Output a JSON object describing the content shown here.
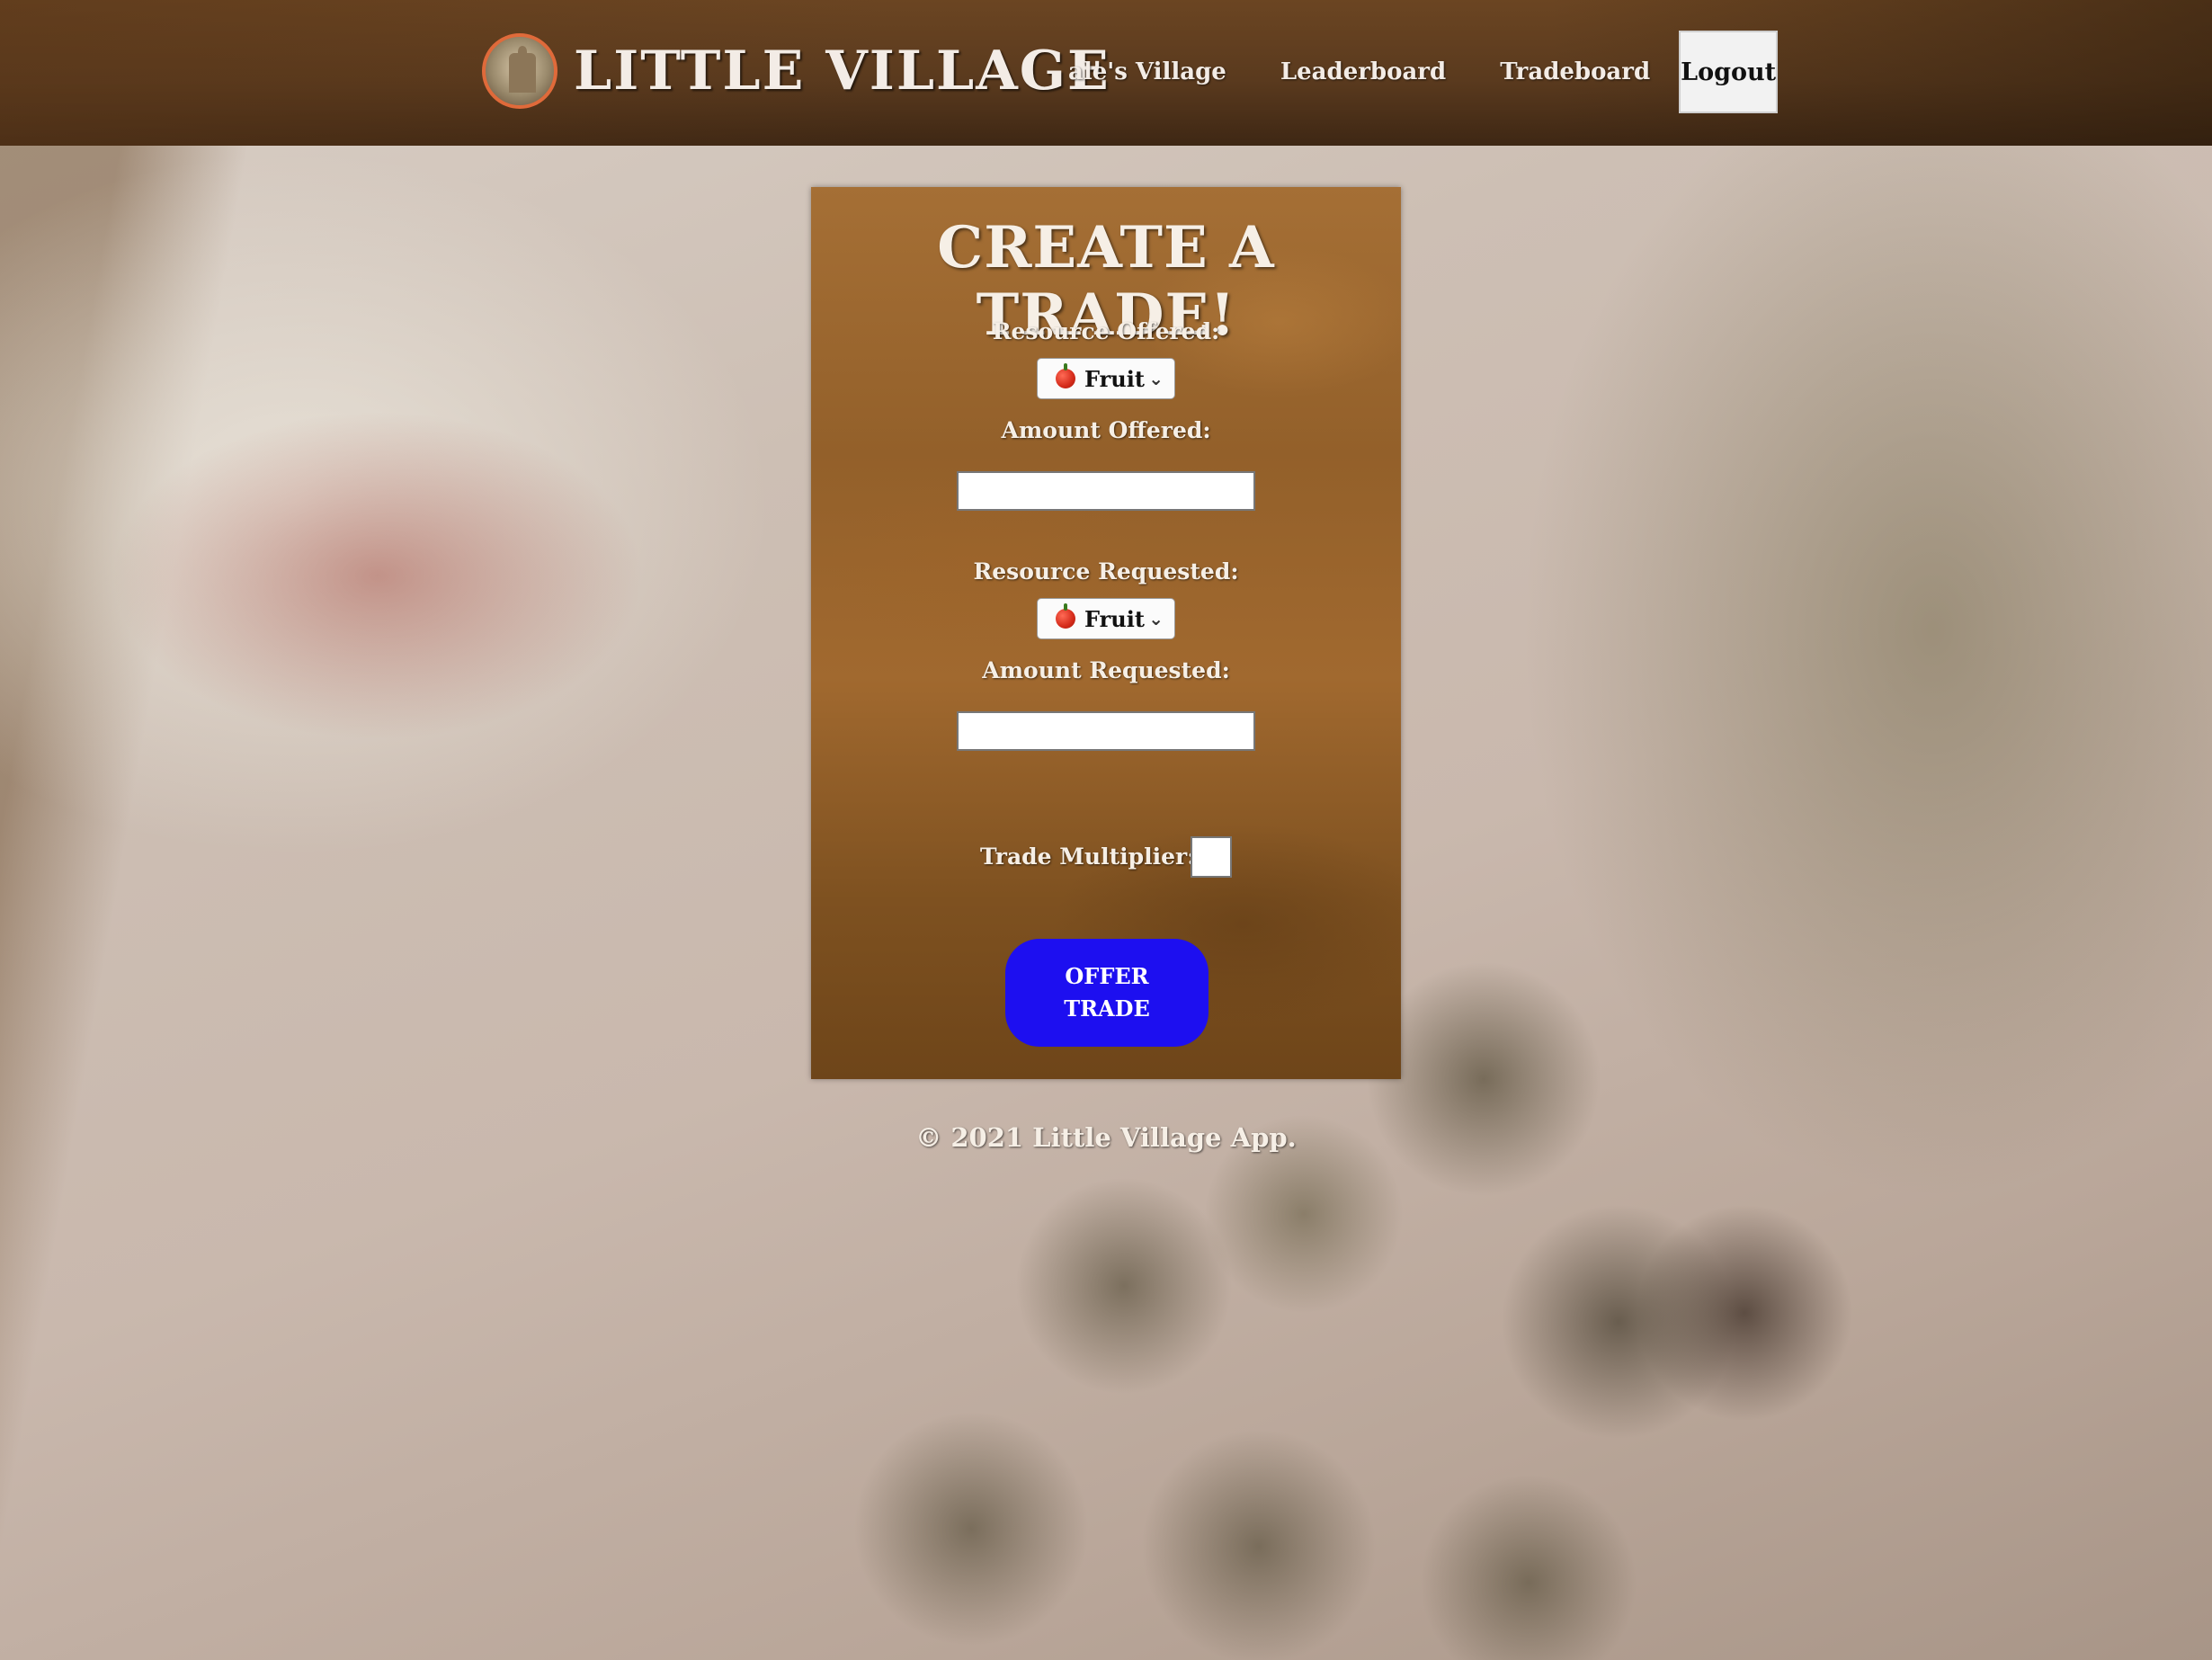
{
  "header": {
    "brand_title": "LITTLE VILLAGE",
    "logo_icon": "village-building-logo",
    "nav": {
      "village": "ale's Village",
      "leaderboard": "Leaderboard",
      "tradeboard": "Tradeboard",
      "logout": "Logout"
    }
  },
  "trade_form": {
    "title": "CREATE A TRADE!",
    "resource_offered_label": "Resource Offered:",
    "resource_offered_value": "Fruit",
    "amount_offered_label": "Amount Offered:",
    "amount_offered_value": "",
    "resource_requested_label": "Resource Requested:",
    "resource_requested_value": "Fruit",
    "amount_requested_label": "Amount Requested:",
    "amount_requested_value": "",
    "trade_multiplier_label": "Trade Multiplier:",
    "trade_multiplier_value": "",
    "resource_icon": "apple-icon",
    "offer_button": "OFFER\nTRADE",
    "button_color": "#1d0ff0"
  },
  "footer": {
    "copyright": "© 2021 Little Village App."
  }
}
